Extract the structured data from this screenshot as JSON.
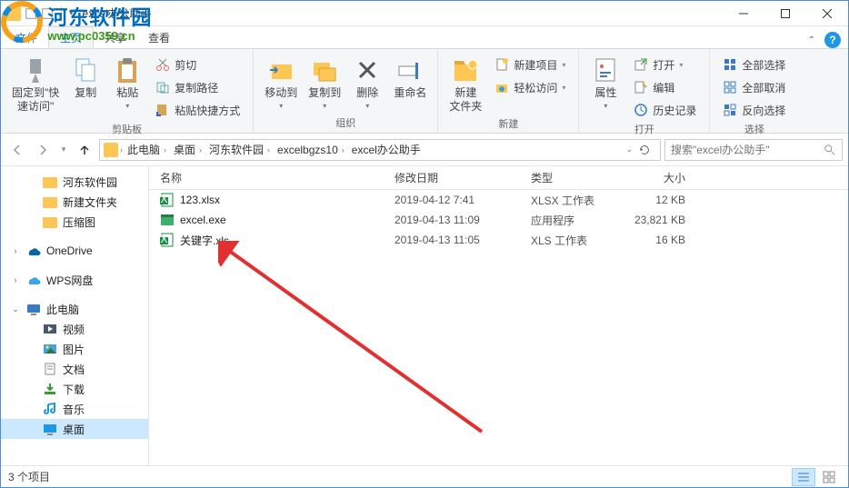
{
  "watermark": {
    "main": "河东软件园",
    "sub": "www.pc0359.cn"
  },
  "title": "excel办公助手",
  "tabs": {
    "menu": "文件",
    "home": "主页",
    "share": "共享",
    "view": "查看"
  },
  "ribbon": {
    "pin": "固定到\"快\n速访问\"",
    "copy": "复制",
    "paste": "粘贴",
    "cut": "剪切",
    "copyPath": "复制路径",
    "pasteShortcut": "粘贴快捷方式",
    "moveTo": "移动到",
    "copyTo": "复制到",
    "delete": "删除",
    "rename": "重命名",
    "newFolder": "新建\n文件夹",
    "newItem": "新建项目",
    "easyAccess": "轻松访问",
    "properties": "属性",
    "open": "打开",
    "edit": "编辑",
    "history": "历史记录",
    "selectAll": "全部选择",
    "selectNone": "全部取消",
    "invertSel": "反向选择",
    "g_clip": "剪贴板",
    "g_org": "组织",
    "g_new": "新建",
    "g_open": "打开",
    "g_sel": "选择"
  },
  "breadcrumb": [
    "此电脑",
    "桌面",
    "河东软件园",
    "excelbgzs10",
    "excel办公助手"
  ],
  "searchPlaceholder": "搜索\"excel办公助手\"",
  "tree": {
    "items": [
      {
        "label": "河东软件园",
        "icon": "folder",
        "indent": 1
      },
      {
        "label": "新建文件夹",
        "icon": "folder",
        "indent": 1
      },
      {
        "label": "压缩图",
        "icon": "folder",
        "indent": 1
      },
      {
        "label": "OneDrive",
        "icon": "onedrive",
        "indent": 0,
        "expandable": true,
        "sep": true
      },
      {
        "label": "WPS网盘",
        "icon": "wps",
        "indent": 0,
        "expandable": true,
        "sep": true
      },
      {
        "label": "此电脑",
        "icon": "pc",
        "indent": 0,
        "expandable": true,
        "expanded": true,
        "sep": true
      },
      {
        "label": "视频",
        "icon": "video",
        "indent": 1
      },
      {
        "label": "图片",
        "icon": "pic",
        "indent": 1
      },
      {
        "label": "文档",
        "icon": "doc",
        "indent": 1
      },
      {
        "label": "下载",
        "icon": "dl",
        "indent": 1
      },
      {
        "label": "音乐",
        "icon": "music",
        "indent": 1
      },
      {
        "label": "桌面",
        "icon": "desktop",
        "indent": 1,
        "selected": true
      }
    ]
  },
  "columns": {
    "name": "名称",
    "date": "修改日期",
    "type": "类型",
    "size": "大小"
  },
  "files": [
    {
      "name": "123.xlsx",
      "date": "2019-04-12 7:41",
      "type": "XLSX 工作表",
      "size": "12 KB",
      "icon": "xlsx"
    },
    {
      "name": "excel.exe",
      "date": "2019-04-13 11:09",
      "type": "应用程序",
      "size": "23,821 KB",
      "icon": "exe"
    },
    {
      "name": "关键字.xls",
      "date": "2019-04-13 11:05",
      "type": "XLS 工作表",
      "size": "16 KB",
      "icon": "xls"
    }
  ],
  "status": "3 个项目"
}
